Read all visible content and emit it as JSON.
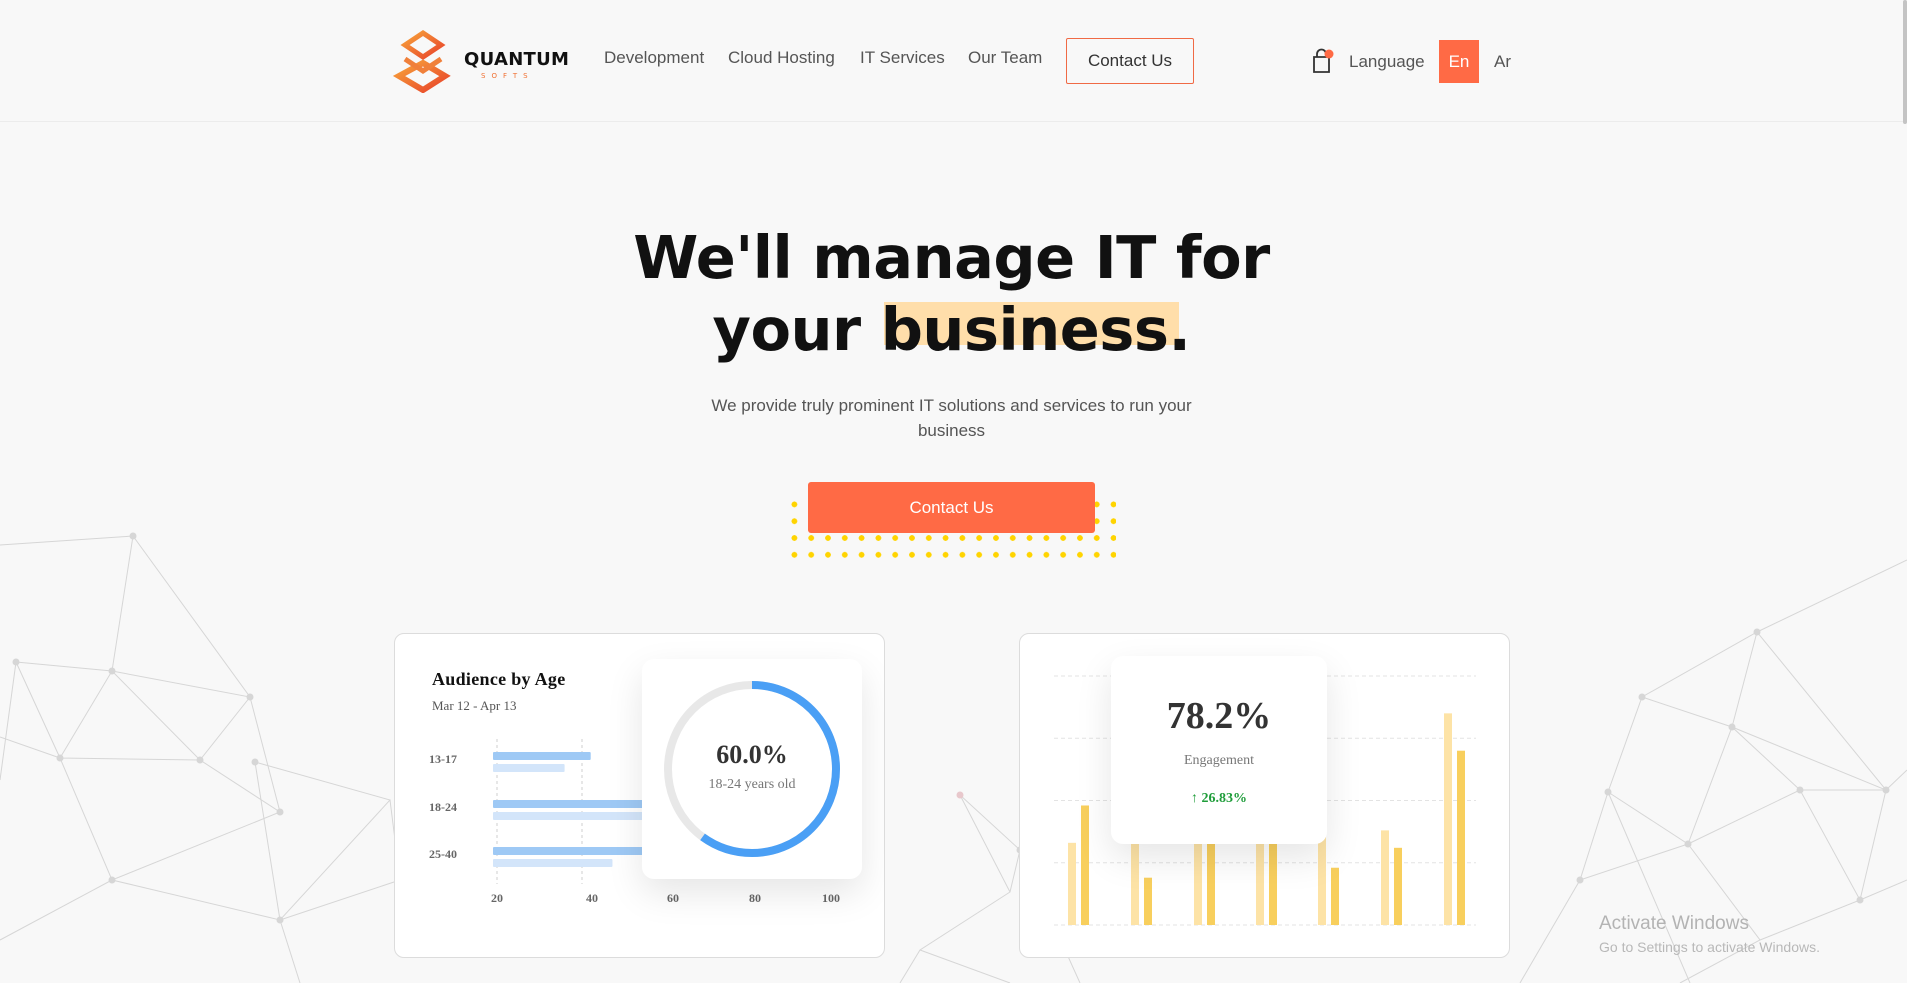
{
  "brand": {
    "name": "QUANTUM",
    "tagline": "SOFTS"
  },
  "nav": {
    "items": [
      "Development",
      "Cloud Hosting",
      "IT Services",
      "Our Team"
    ],
    "contact_label": "Contact Us",
    "language_label": "Language",
    "lang_active": "En",
    "lang_other": "Ar"
  },
  "hero": {
    "title_line1": "We'll manage IT for",
    "title_line2_plain": "your",
    "title_line2_highlight": "business.",
    "subtitle": "We provide truly prominent IT solutions and services to run your business",
    "cta_label": "Contact Us"
  },
  "audience_card": {
    "title": "Audience by Age",
    "date_range": "Mar 12 - Apr 13",
    "donut_value": "60.0%",
    "donut_label": "18-24 years old",
    "donut_fraction": 0.6
  },
  "engagement_card": {
    "value": "78.2%",
    "label": "Engagement",
    "delta": "26.83%"
  },
  "chart_data": [
    {
      "type": "bar",
      "orientation": "horizontal",
      "title": "Audience by Age",
      "subtitle": "Mar 12 - Apr 13",
      "categories": [
        "13-17",
        "18-24",
        "25-40"
      ],
      "series": [
        {
          "values": [
            42,
            62,
            62
          ]
        },
        {
          "values": [
            36,
            62,
            47
          ]
        }
      ],
      "x_ticks": [
        "20",
        "40",
        "60",
        "80",
        "100"
      ],
      "xlim": [
        20,
        100
      ]
    },
    {
      "type": "bar",
      "title": "",
      "series": [
        {
          "values": [
            33,
            41,
            33,
            40,
            45,
            38,
            85
          ]
        },
        {
          "values": [
            48,
            19,
            41,
            40,
            23,
            31,
            70
          ]
        }
      ],
      "ylim": [
        0,
        100
      ],
      "grid": true
    }
  ],
  "os": {
    "watermark": "Activate Windows",
    "watermark_sub": "Go to Settings to activate Windows."
  }
}
